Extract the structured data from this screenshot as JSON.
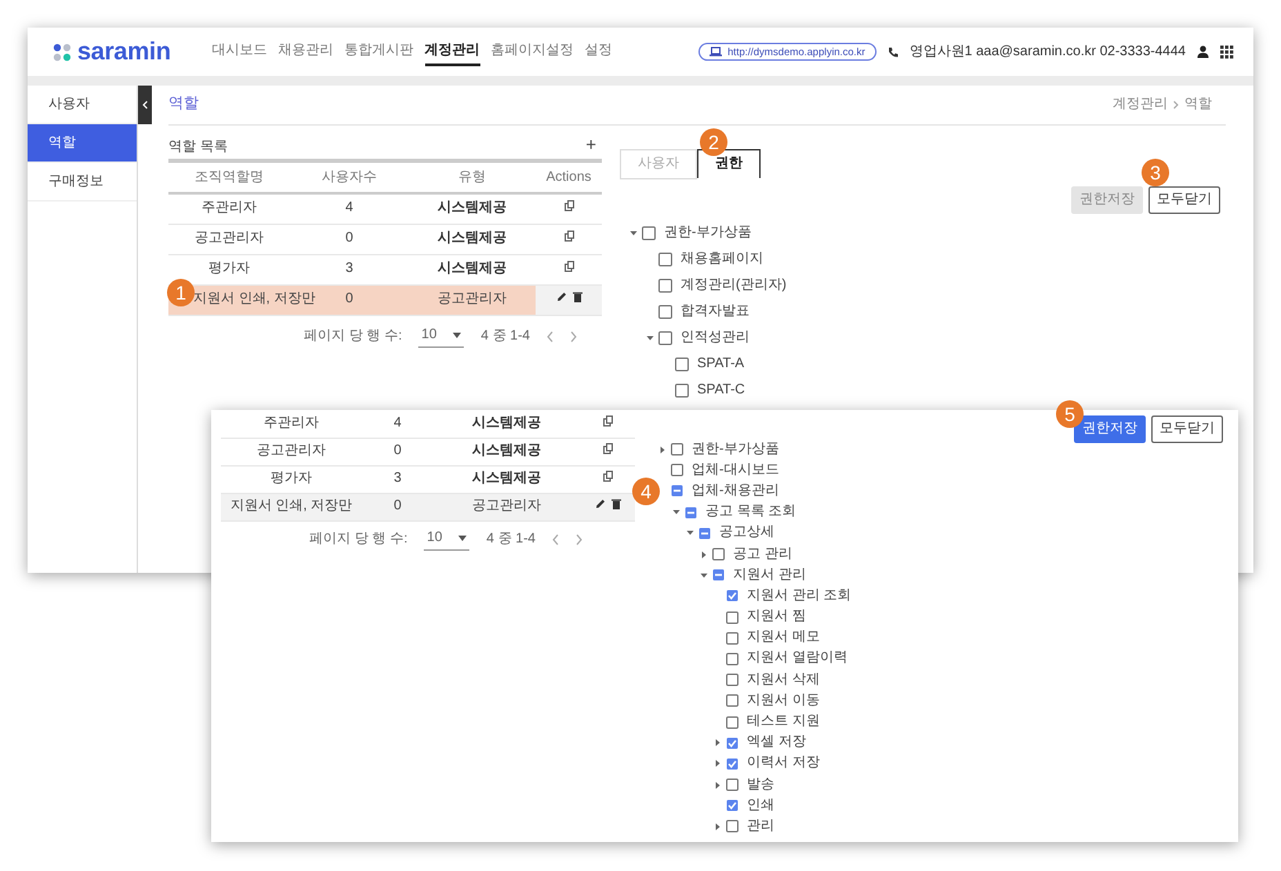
{
  "back_window": {
    "logo": "saramin",
    "nav": [
      {
        "label": "대시보드",
        "selected": false
      },
      {
        "label": "채용관리",
        "selected": false
      },
      {
        "label": "통합게시판",
        "selected": false
      },
      {
        "label": "계정관리",
        "selected": true
      },
      {
        "label": "홈페이지설정",
        "selected": false
      },
      {
        "label": "설정",
        "selected": false
      }
    ],
    "url": "http://dymsdemo.applyin.co.kr",
    "user_info": "영업사원1 aaa@saramin.co.kr 02-3333-4444",
    "sidebar": [
      {
        "label": "사용자",
        "selected": false
      },
      {
        "label": "역할",
        "selected": true
      },
      {
        "label": "구매정보",
        "selected": false
      }
    ],
    "page_title": "역할",
    "breadcrumb": [
      "계정관리",
      "역할"
    ],
    "role_list": {
      "title": "역할 목록",
      "add": "+",
      "columns": [
        "조직역할명",
        "사용자수",
        "유형",
        "Actions"
      ],
      "rows": [
        {
          "name": "주관리자",
          "users": "4",
          "type": "시스템제공",
          "kind": "system",
          "selected": false,
          "highlighted": false
        },
        {
          "name": "공고관리자",
          "users": "0",
          "type": "시스템제공",
          "kind": "system",
          "selected": false,
          "highlighted": false
        },
        {
          "name": "평가자",
          "users": "3",
          "type": "시스템제공",
          "kind": "system",
          "selected": false,
          "highlighted": false
        },
        {
          "name": "지원서 인쇄, 저장만",
          "users": "0",
          "type": "공고관리자",
          "kind": "custom",
          "selected": true,
          "highlighted": true,
          "callout": "1"
        }
      ],
      "pagination": {
        "rows_label": "페이지 당 행 수:",
        "rows_value": "10",
        "range": "4 중 1-4"
      }
    },
    "tabs": [
      {
        "label": "사용자",
        "selected": false
      },
      {
        "label": "권한",
        "selected": true,
        "callout": "2"
      }
    ],
    "buttons": [
      {
        "label": "권한저장",
        "kind": "save",
        "disabled": true
      },
      {
        "label": "모두닫기",
        "kind": "close",
        "callout": "3"
      }
    ],
    "tree": [
      {
        "label": "권한-부가상품",
        "checked": false,
        "expanded": true,
        "children": [
          {
            "label": "채용홈페이지",
            "checked": false
          },
          {
            "label": "계정관리(관리자)",
            "checked": false
          },
          {
            "label": "합격자발표",
            "checked": false
          },
          {
            "label": "인적성관리",
            "checked": false,
            "expanded": true,
            "children": [
              {
                "label": "SPAT-A",
                "checked": false
              },
              {
                "label": "SPAT-C",
                "checked": false
              }
            ]
          }
        ]
      }
    ]
  },
  "front_window": {
    "rows": [
      {
        "name": "주관리자",
        "users": "4",
        "type": "시스템제공",
        "kind": "system",
        "selected": false
      },
      {
        "name": "공고관리자",
        "users": "0",
        "type": "시스템제공",
        "kind": "system",
        "selected": false
      },
      {
        "name": "평가자",
        "users": "3",
        "type": "시스템제공",
        "kind": "system",
        "selected": false
      },
      {
        "name": "지원서 인쇄, 저장만",
        "users": "0",
        "type": "공고관리자",
        "kind": "custom",
        "selected": true
      }
    ],
    "pagination": {
      "rows_label": "페이지 당 행 수:",
      "rows_value": "10",
      "range": "4 중 1-4"
    },
    "buttons": [
      {
        "label": "권한저장",
        "kind": "save",
        "disabled": false,
        "callout": "5"
      },
      {
        "label": "모두닫기",
        "kind": "close"
      }
    ],
    "tree": [
      {
        "label": "권한-부가상품",
        "checked": false,
        "expanded": false
      },
      {
        "label": "업체-대시보드",
        "checked": false
      },
      {
        "label": "업체-채용관리",
        "checked": false,
        "partial": true,
        "callout": "4",
        "children": [
          {
            "label": "공고 목록 조회",
            "checked": false,
            "partial": true,
            "expanded": true,
            "children": [
              {
                "label": "공고상세",
                "checked": false,
                "partial": true,
                "expanded": true,
                "children": [
                  {
                    "label": "공고 관리",
                    "checked": false,
                    "expanded": false
                  },
                  {
                    "label": "지원서 관리",
                    "checked": false,
                    "partial": true,
                    "expanded": true,
                    "children": [
                      {
                        "label": "지원서 관리 조회",
                        "checked": true
                      },
                      {
                        "label": "지원서 찜",
                        "checked": false
                      },
                      {
                        "label": "지원서 메모",
                        "checked": false
                      },
                      {
                        "label": "지원서 열람이력",
                        "checked": false
                      },
                      {
                        "label": "지원서 삭제",
                        "checked": false
                      },
                      {
                        "label": "지원서 이동",
                        "checked": false
                      },
                      {
                        "label": "테스트 지원",
                        "checked": false
                      },
                      {
                        "label": "엑셀 저장",
                        "checked": true,
                        "expanded": false
                      },
                      {
                        "label": "이력서 저장",
                        "checked": true,
                        "expanded": false
                      },
                      {
                        "label": "발송",
                        "checked": false,
                        "expanded": false
                      },
                      {
                        "label": "인쇄",
                        "checked": true
                      },
                      {
                        "label": "관리",
                        "checked": false,
                        "expanded": false
                      }
                    ]
                  }
                ]
              }
            ]
          }
        ]
      }
    ]
  }
}
